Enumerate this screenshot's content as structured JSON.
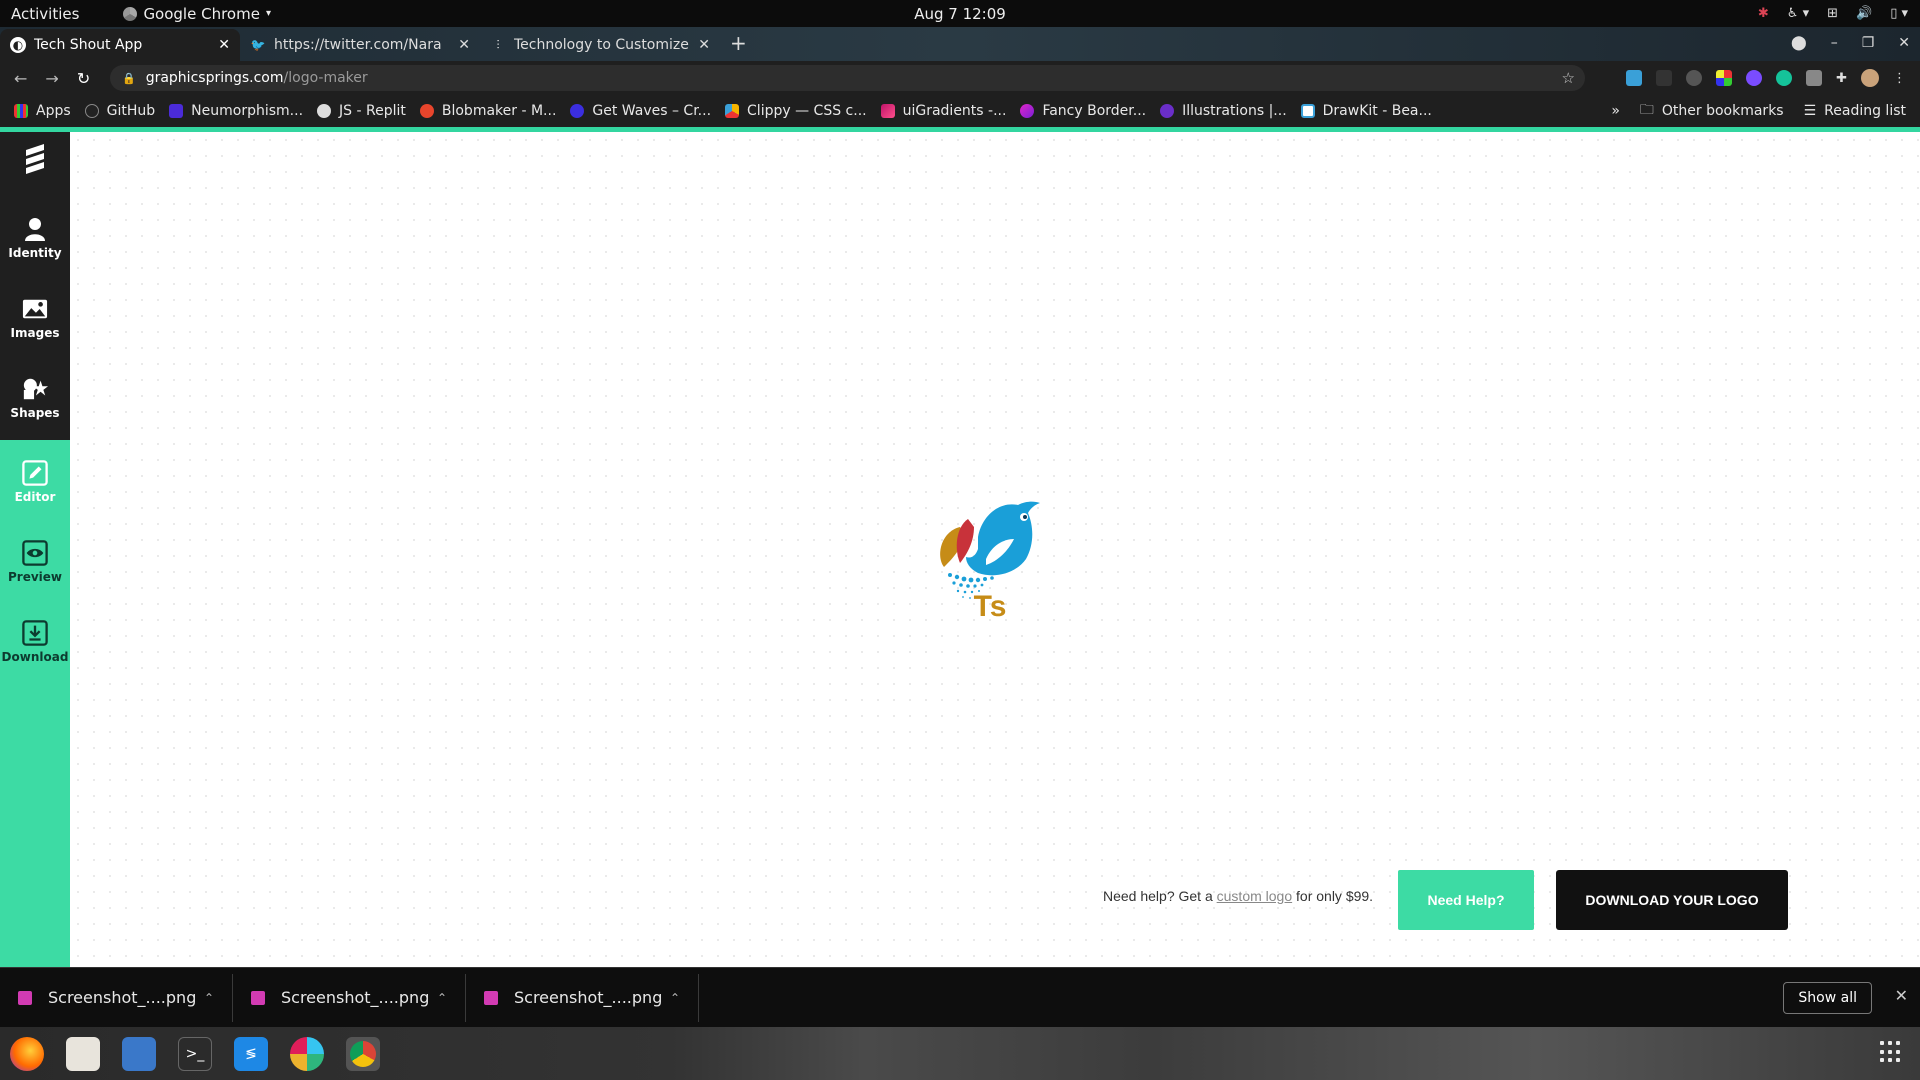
{
  "topbar": {
    "activities": "Activities",
    "app_name": "Google Chrome",
    "clock": "Aug 7  12:09"
  },
  "tabs": [
    {
      "title": "Tech Shout App",
      "favicon": "app-icon",
      "active": true
    },
    {
      "title": "https://twitter.com/Nara",
      "favicon": "twitter-icon",
      "active": false
    },
    {
      "title": "Technology to Customize",
      "favicon": "page-icon",
      "active": false
    }
  ],
  "omnibox": {
    "host": "graphicsprings.com",
    "path": "/logo-maker"
  },
  "bookmarks": {
    "items": [
      "Apps",
      "GitHub",
      "Neumorphism...",
      "JS - Replit",
      "Blobmaker - M...",
      "Get Waves – Cr...",
      "Clippy — CSS c...",
      "uiGradients -...",
      "Fancy Border...",
      "Illustrations |...",
      "DrawKit - Bea..."
    ],
    "overflow": "»",
    "other": "Other bookmarks",
    "reading_list": "Reading list"
  },
  "sidebar": {
    "items": [
      {
        "label": "Identity",
        "icon": "person-icon"
      },
      {
        "label": "Images",
        "icon": "image-icon"
      },
      {
        "label": "Shapes",
        "icon": "shapes-icon"
      },
      {
        "label": "Editor",
        "icon": "edit-icon"
      },
      {
        "label": "Preview",
        "icon": "eye-icon"
      },
      {
        "label": "Download",
        "icon": "download-icon"
      }
    ]
  },
  "logo": {
    "text": "Ts",
    "text_color": "#c68c17",
    "bird_color": "#1a9fd8"
  },
  "footer_cta": {
    "help_prefix": "Need help? Get a",
    "help_link": "custom logo",
    "help_suffix": "for only $99.",
    "need_help_button": "Need Help?",
    "download_button": "DOWNLOAD YOUR LOGO"
  },
  "downloads": {
    "items": [
      "Screenshot_....png",
      "Screenshot_....png",
      "Screenshot_....png"
    ],
    "show_all": "Show all"
  },
  "colors": {
    "accent_green": "#3ddba4",
    "sidebar_dark": "#1f1f1f",
    "download_button": "#111111"
  }
}
